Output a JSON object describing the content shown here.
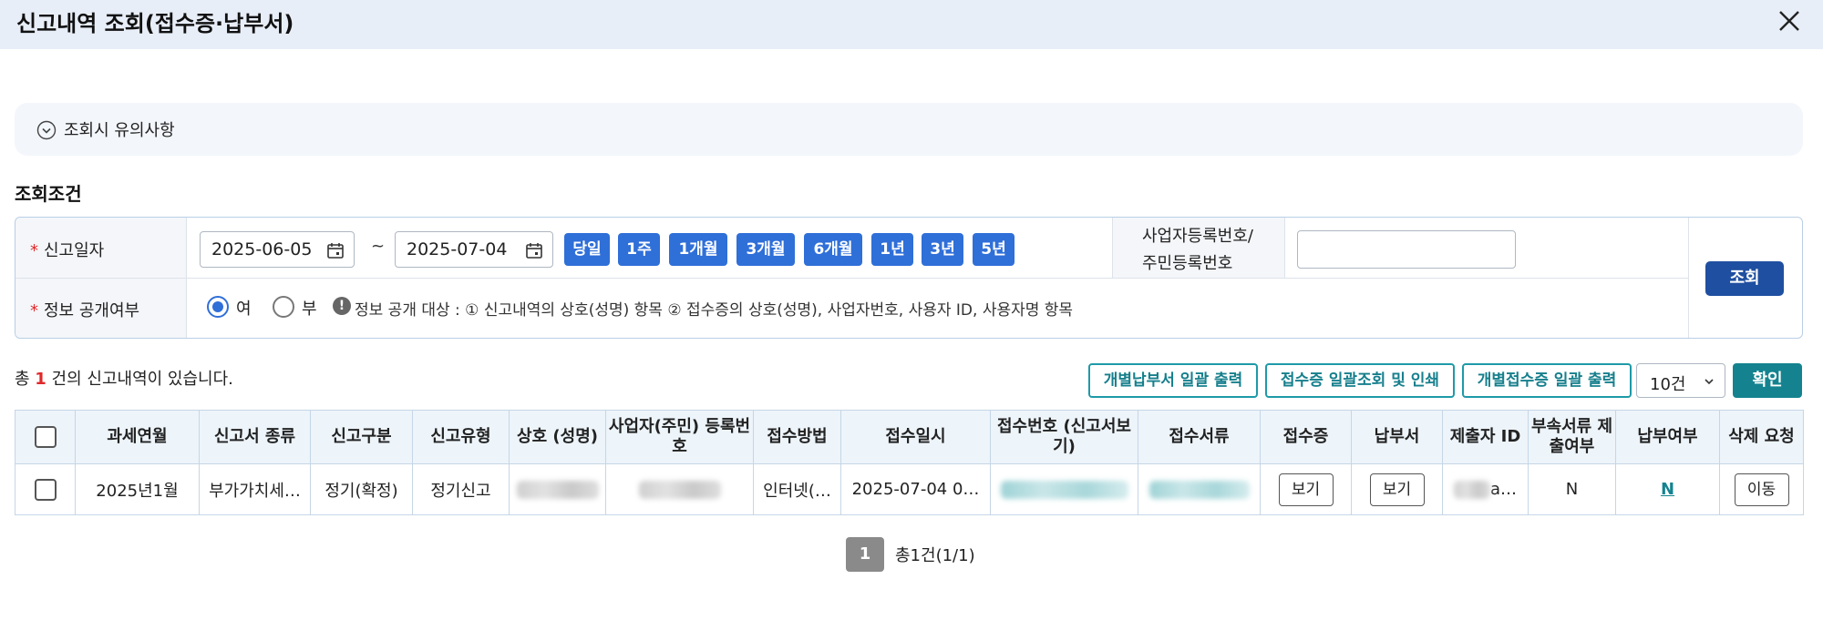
{
  "window": {
    "title": "신고내역 조회(접수증·납부서)",
    "close_icon": "close-icon"
  },
  "notice": {
    "label": "조회시 유의사항",
    "icon": "chevron-down-circle-icon"
  },
  "conditions": {
    "section_title": "조회조건",
    "report_date": {
      "label": "신고일자",
      "from": "2025-06-05",
      "to": "2025-07-04",
      "separator": "~",
      "period_buttons": [
        "당일",
        "1주",
        "1개월",
        "3개월",
        "6개월",
        "1년",
        "3년",
        "5년"
      ]
    },
    "bizno": {
      "label_line1": "사업자등록번호/",
      "label_line2": "주민등록번호",
      "value": ""
    },
    "disclosure": {
      "label": "정보 공개여부",
      "options": [
        "여",
        "부"
      ],
      "selected": "여",
      "info": "정보 공개 대상 : ① 신고내역의 상호(성명) 항목 ② 접수증의 상호(성명), 사업자번호, 사용자 ID, 사용자명 항목"
    },
    "search_label": "조회",
    "required_mark": "*"
  },
  "results": {
    "count_prefix": "총 ",
    "count": "1",
    "count_suffix": " 건의 신고내역이 있습니다.",
    "actions": [
      "개별납부서 일괄 출력",
      "접수증 일괄조회 및 인쇄",
      "개별접수증 일괄 출력"
    ],
    "page_size": "10건",
    "confirm_label": "확인"
  },
  "table": {
    "headers": {
      "period": "과세연월",
      "type": "신고서 종류",
      "category": "신고구분",
      "kind": "신고유형",
      "company": "상호 (성명)",
      "regno": "사업자(주민) 등록번호",
      "method": "접수방법",
      "datetime": "접수일시",
      "receipt_no": "접수번호 (신고서보기)",
      "docs": "접수서류",
      "receipt": "접수증",
      "bill": "납부서",
      "submitter": "제출자 ID",
      "attach": "부속서류 제출여부",
      "paid": "납부여부",
      "delete": "삭제 요청"
    },
    "row": {
      "period": "2025년1월",
      "type": "부가가치세…",
      "category": "정기(확정)",
      "kind": "정기신고",
      "method": "인터넷(…",
      "datetime": "2025-07-04 0…",
      "receipt_btn": "보기",
      "bill_btn": "보기",
      "submitter": "a…",
      "attach": "N",
      "paid": "N",
      "delete_btn": "이동"
    }
  },
  "pagination": {
    "current": "1",
    "info": "총1건(1/1)"
  },
  "colors": {
    "primary": "#2f6fd8",
    "search": "#1f4fa0",
    "teal": "#14838f",
    "required": "#e0282a"
  }
}
